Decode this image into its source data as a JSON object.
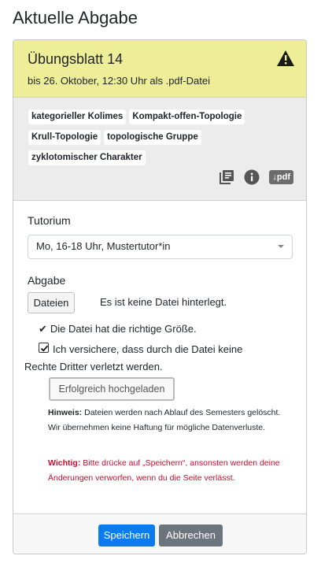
{
  "page": {
    "title": "Aktuelle Abgabe"
  },
  "sheet": {
    "title": "Übungsblatt 14",
    "deadline": "bis 26. Oktober, 12:30 Uhr als .pdf-Datei",
    "tags": [
      "kategorieller Kolimes",
      "Kompakt-offen-Topologie",
      "Krull-Topologie",
      "topologische Gruppe",
      "zyklotomischer Charakter"
    ],
    "pdf_label": "↓pdf"
  },
  "form": {
    "tutorium_label": "Tutorium",
    "tutorium_value": "Mo, 16-18 Uhr, Mustertutor*in",
    "abgabe_label": "Abgabe",
    "file_button": "Dateien",
    "no_file_text": "Es ist keine Datei hinterlegt.",
    "size_ok_text": "Die Datei hat die richtige Größe.",
    "assure_line1": "Ich versichere, dass durch die Datei keine",
    "assure_line2": "Rechte Dritter verletzt werden.",
    "upload_status": "Erfolgreich hochgeladen",
    "hint_label": "Hinweis:",
    "hint_text": "Dateien werden nach Ablauf des Semesters gelöscht. Wir übernehmen keine Haftung für mögliche Datenverluste.",
    "warn_label": "Wichtig:",
    "warn_text": "Bitte drücke auf „Speichern“, ansonsten werden deine Änderungen verworfen, wenn du die Seite verlässt."
  },
  "footer": {
    "save_label": "Speichern",
    "cancel_label": "Abbrechen"
  },
  "colors": {
    "header_bg": "#eeee99",
    "primary": "#0d7bf0",
    "secondary": "#6c757d",
    "warning_text": "#c8102e"
  }
}
